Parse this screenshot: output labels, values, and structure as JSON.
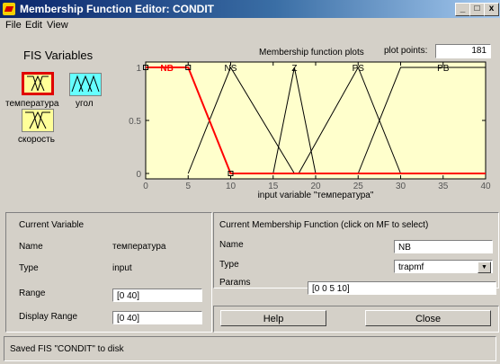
{
  "window": {
    "title": "Membership Function Editor: CONDIT"
  },
  "menu": [
    "File",
    "Edit",
    "View"
  ],
  "fis": {
    "title": "FIS Variables",
    "variables": [
      {
        "name": "температура",
        "color": "#ffff99",
        "selected": true
      },
      {
        "name": "угол",
        "color": "#66ffff",
        "selected": false
      },
      {
        "name": "скорость",
        "color": "#ffff99",
        "selected": false
      }
    ]
  },
  "plot": {
    "title": "Membership function plots",
    "points_label": "plot points:",
    "points_value": "181",
    "xlabel": "input variable \"температура\""
  },
  "chart_data": {
    "type": "line",
    "xlim": [
      0,
      40
    ],
    "ylim": [
      0,
      1
    ],
    "x_ticks": [
      "0",
      "5",
      "10",
      "15",
      "20",
      "25",
      "30",
      "35",
      "40"
    ],
    "y_ticks": [
      "0",
      "0.5",
      "1"
    ],
    "xlabel": "input variable \"температура\"",
    "selected_series": "NB",
    "series": [
      {
        "name": "NB",
        "points": [
          [
            0,
            1
          ],
          [
            5,
            1
          ],
          [
            10,
            0
          ],
          [
            40,
            0
          ]
        ]
      },
      {
        "name": "NS",
        "points": [
          [
            5,
            0
          ],
          [
            10,
            1
          ],
          [
            17.5,
            0
          ]
        ]
      },
      {
        "name": "Z",
        "points": [
          [
            15,
            0
          ],
          [
            17.5,
            1
          ],
          [
            20,
            0
          ]
        ]
      },
      {
        "name": "PS",
        "points": [
          [
            18,
            0
          ],
          [
            25,
            1
          ],
          [
            30,
            0
          ]
        ]
      },
      {
        "name": "PB",
        "points": [
          [
            25,
            0
          ],
          [
            30,
            1
          ],
          [
            40,
            1
          ]
        ]
      }
    ],
    "label_positions": {
      "NB": 2.5,
      "NS": 10,
      "Z": 17.5,
      "PS": 25,
      "PB": 35
    },
    "colors": {
      "selected": "#ff0000",
      "normal": "#000000",
      "background": "#ffffcc"
    }
  },
  "current_variable": {
    "title": "Current Variable",
    "name_label": "Name",
    "name_value": "температура",
    "type_label": "Type",
    "type_value": "input",
    "range_label": "Range",
    "range_value": "[0 40]",
    "display_range_label": "Display Range",
    "display_range_value": "[0 40]"
  },
  "current_mf": {
    "title": "Current Membership Function (click on MF to select)",
    "name_label": "Name",
    "name_value": "NB",
    "type_label": "Type",
    "type_value": "trapmf",
    "params_label": "Params",
    "params_value": "[0 0 5 10]"
  },
  "buttons": {
    "help": "Help",
    "close": "Close"
  },
  "status": "Saved FIS \"CONDIT\" to disk"
}
